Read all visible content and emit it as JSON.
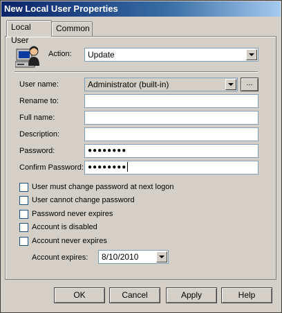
{
  "window": {
    "title": "New Local User Properties"
  },
  "tabs": [
    {
      "label": "Local User"
    },
    {
      "label": "Common"
    }
  ],
  "action": {
    "label": "Action:",
    "value": "Update"
  },
  "form": {
    "user_name": {
      "label": "User name:",
      "value": "Administrator (built-in)",
      "browse": "..."
    },
    "rename_to": {
      "label": "Rename to:",
      "value": ""
    },
    "full_name": {
      "label": "Full name:",
      "value": ""
    },
    "description": {
      "label": "Description:",
      "value": ""
    },
    "password": {
      "label": "Password:",
      "value": "●●●●●●●●"
    },
    "confirm_password": {
      "label": "Confirm Password:",
      "value": "●●●●●●●●"
    }
  },
  "checkboxes": [
    {
      "label": "User must change password at next logon",
      "checked": false
    },
    {
      "label": "User cannot change password",
      "checked": false
    },
    {
      "label": "Password never expires",
      "checked": false
    },
    {
      "label": "Account is disabled",
      "checked": false
    },
    {
      "label": "Account never expires",
      "checked": false
    }
  ],
  "expires": {
    "label": "Account expires:",
    "value": "8/10/2010"
  },
  "buttons": {
    "ok": "OK",
    "cancel": "Cancel",
    "apply": "Apply",
    "help": "Help"
  }
}
